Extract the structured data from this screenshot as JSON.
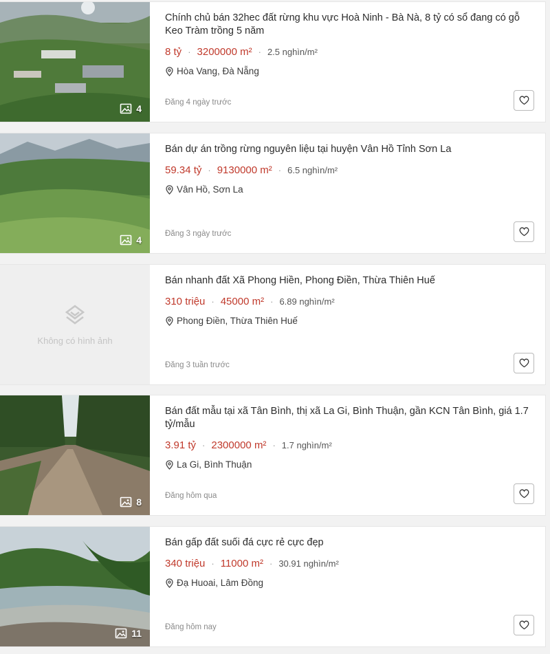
{
  "listings": [
    {
      "title": "Chính chủ bán 32hec đất rừng khu vực Hoà Ninh - Bà Nà, 8 tỷ có sổ đang có gỗ Keo Tràm trồng 5 năm",
      "price": "8 tỷ",
      "area": "3200000 m²",
      "price_per_m2": "2.5 nghìn/m²",
      "location": "Hòa Vang, Đà Nẵng",
      "posted": "Đăng 4 ngày trước",
      "photo_count": "4"
    },
    {
      "title": "Bán dự án trồng rừng nguyên liệu tại huyện Vân Hồ Tỉnh Sơn La",
      "price": "59.34 tỷ",
      "area": "9130000 m²",
      "price_per_m2": "6.5 nghìn/m²",
      "location": "Vân Hồ, Sơn La",
      "posted": "Đăng 3 ngày trước",
      "photo_count": "4"
    },
    {
      "title": "Bán nhanh đất Xã Phong Hiền, Phong Điền, Thừa Thiên Huế",
      "price": "310 triệu",
      "area": "45000 m²",
      "price_per_m2": "6.89 nghìn/m²",
      "location": "Phong Điền, Thừa Thiên Huế",
      "posted": "Đăng 3 tuần trước",
      "no_image_text": "Không có hình ảnh"
    },
    {
      "title": "Bán đất mẫu tại xã Tân Bình, thị xã La Gi, Bình Thuận, gần KCN Tân Bình, giá 1.7 tỷ/mẫu",
      "price": "3.91 tỷ",
      "area": "2300000 m²",
      "price_per_m2": "1.7 nghìn/m²",
      "location": "La Gi, Bình Thuận",
      "posted": "Đăng hôm qua",
      "photo_count": "8"
    },
    {
      "title": "Bán gấp đất suối đá cực rẻ cực đẹp",
      "price": "340 triệu",
      "area": "11000 m²",
      "price_per_m2": "30.91 nghìn/m²",
      "location": "Đạ Huoai, Lâm Đồng",
      "posted": "Đăng hôm nay",
      "photo_count": "11"
    }
  ],
  "separator": "·",
  "colors": {
    "price": "#c0392b",
    "muted": "#8a8a8a"
  }
}
